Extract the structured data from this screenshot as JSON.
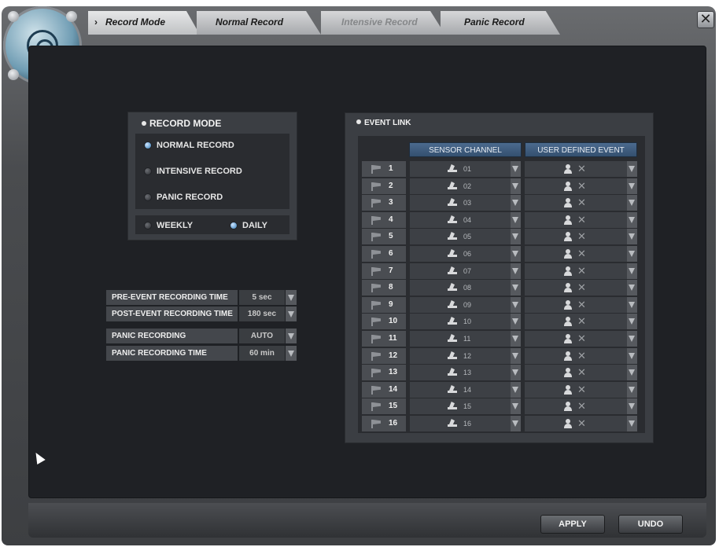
{
  "tabs": [
    {
      "label": "Record Mode",
      "active": true
    },
    {
      "label": "Normal Record"
    },
    {
      "label": "Intensive Record",
      "disabled": true
    },
    {
      "label": "Panic Record"
    }
  ],
  "close_glyph": "✕",
  "record_mode": {
    "title": "RECORD MODE",
    "options": [
      "NORMAL RECORD",
      "INTENSIVE RECORD",
      "PANIC RECORD"
    ],
    "selected": "NORMAL RECORD",
    "schedule": [
      "WEEKLY",
      "DAILY"
    ],
    "schedule_selected": "DAILY"
  },
  "settings": [
    {
      "label": "PRE-EVENT RECORDING TIME",
      "value": "5 sec"
    },
    {
      "label": "POST-EVENT RECORDING TIME",
      "value": "180 sec"
    },
    {
      "label": "PANIC RECORDING",
      "value": "AUTO"
    },
    {
      "label": "PANIC RECORDING TIME",
      "value": "60 min"
    }
  ],
  "event_link": {
    "title": "EVENT LINK",
    "col_sensor": "SENSOR CHANNEL",
    "col_user": "USER DEFINED EVENT",
    "rows": [
      {
        "num": "1",
        "sensor": "01",
        "user": "✕"
      },
      {
        "num": "2",
        "sensor": "02",
        "user": "✕"
      },
      {
        "num": "3",
        "sensor": "03",
        "user": "✕"
      },
      {
        "num": "4",
        "sensor": "04",
        "user": "✕"
      },
      {
        "num": "5",
        "sensor": "05",
        "user": "✕"
      },
      {
        "num": "6",
        "sensor": "06",
        "user": "✕"
      },
      {
        "num": "7",
        "sensor": "07",
        "user": "✕"
      },
      {
        "num": "8",
        "sensor": "08",
        "user": "✕"
      },
      {
        "num": "9",
        "sensor": "09",
        "user": "✕"
      },
      {
        "num": "10",
        "sensor": "10",
        "user": "✕"
      },
      {
        "num": "11",
        "sensor": "11",
        "user": "✕"
      },
      {
        "num": "12",
        "sensor": "12",
        "user": "✕"
      },
      {
        "num": "13",
        "sensor": "13",
        "user": "✕"
      },
      {
        "num": "14",
        "sensor": "14",
        "user": "✕"
      },
      {
        "num": "15",
        "sensor": "15",
        "user": "✕"
      },
      {
        "num": "16",
        "sensor": "16",
        "user": "✕"
      }
    ]
  },
  "buttons": {
    "apply": "APPLY",
    "undo": "UNDO"
  },
  "colors": {
    "accent": "#3f5f84",
    "radio_on": "#6fa5d4"
  }
}
